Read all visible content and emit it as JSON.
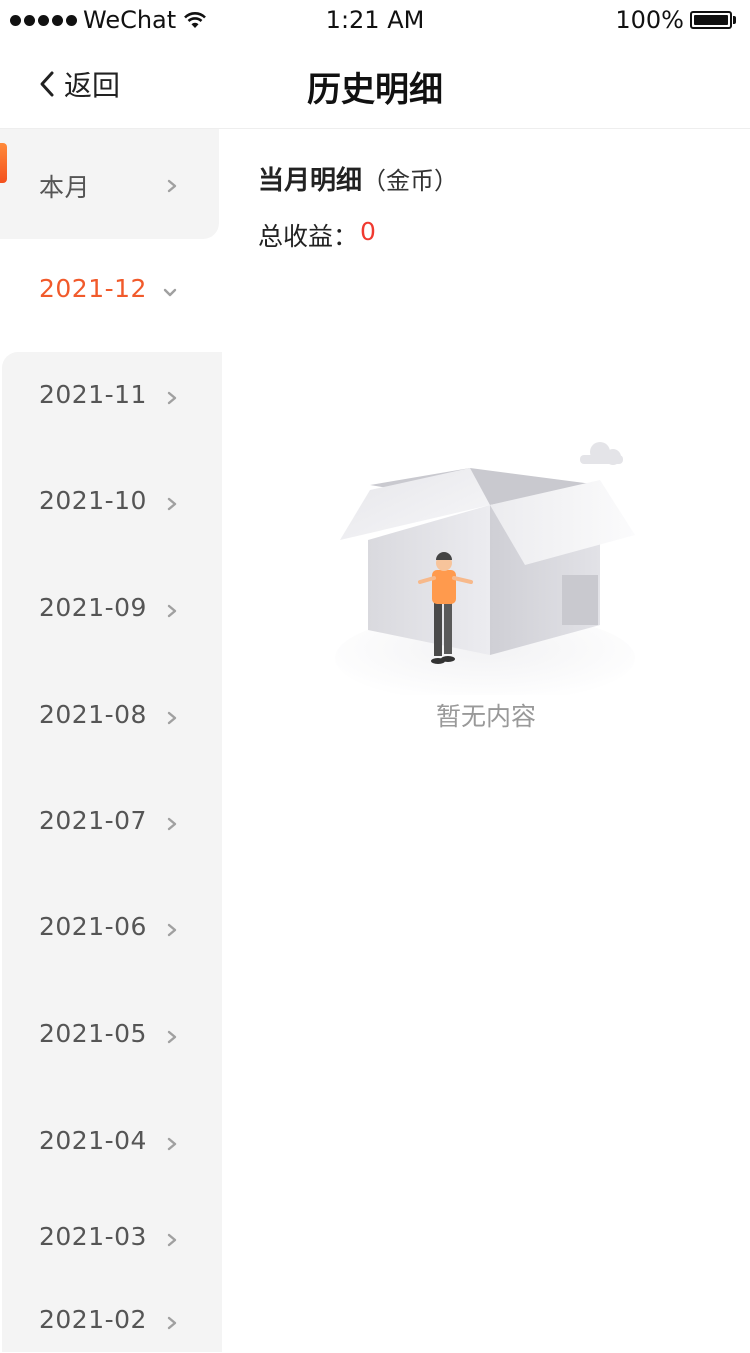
{
  "status_bar": {
    "carrier": "WeChat",
    "time": "1:21 AM",
    "battery": "100%",
    "battery_level": 1.0
  },
  "nav": {
    "back_label": "返回",
    "title": "历史明细"
  },
  "sidebar": {
    "items": [
      {
        "label": "本月",
        "active": false
      },
      {
        "label": "2021-12",
        "active": true
      },
      {
        "label": "2021-11",
        "active": false
      },
      {
        "label": "2021-10",
        "active": false
      },
      {
        "label": "2021-09",
        "active": false
      },
      {
        "label": "2021-08",
        "active": false
      },
      {
        "label": "2021-07",
        "active": false
      },
      {
        "label": "2021-06",
        "active": false
      },
      {
        "label": "2021-05",
        "active": false
      },
      {
        "label": "2021-04",
        "active": false
      },
      {
        "label": "2021-03",
        "active": false
      },
      {
        "label": "2021-02",
        "active": false
      }
    ]
  },
  "content": {
    "title": "当月明细",
    "unit": "（金币）",
    "total_label": "总收益：",
    "total_value": "0",
    "empty_text": "暂无内容"
  },
  "colors": {
    "accent": "#f15a2b",
    "total_value": "#f03a30",
    "sidebar_bg": "#f4f4f4",
    "muted_text": "#999999"
  },
  "icons": {
    "back": "chevron-left-icon",
    "collapsed": "chevron-right-icon",
    "expanded": "chevron-down-icon",
    "wifi": "wifi-icon",
    "battery": "battery-icon",
    "signal": "signal-dots-icon",
    "empty": "empty-box-illustration"
  }
}
